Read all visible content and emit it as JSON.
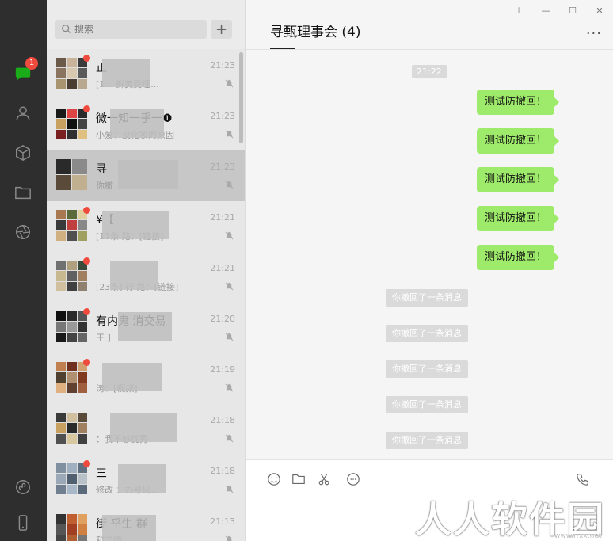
{
  "nav": {
    "chat_badge": "1"
  },
  "search": {
    "placeholder": "搜索",
    "add_label": "+"
  },
  "chat_list": [
    {
      "name": "正",
      "time": "21:23",
      "msg": "[1... 鲜美受理...",
      "dot": true
    },
    {
      "name": "微一知一乎一❶",
      "time": "21:23",
      "msg": "小爱：没化妆的原因",
      "dot": true
    },
    {
      "name": "寻",
      "time": "21:23",
      "msg": "你撤",
      "dot": false
    },
    {
      "name": "¥【",
      "time": "21:21",
      "msg": "[11条 路：[链接]",
      "dot": true
    },
    {
      "name": "",
      "time": "21:21",
      "msg": "[23条] 行 路：[链接]",
      "dot": true
    },
    {
      "name": "有内鬼 消交易",
      "time": "21:20",
      "msg": "王 ]",
      "dot": true
    },
    {
      "name": "",
      "time": "21:19",
      "msg": "涛：[视频]",
      "dot": true
    },
    {
      "name": "",
      "time": "21:18",
      "msg": "：我不够优秀",
      "dot": false
    },
    {
      "name": "三",
      "time": "21:18",
      "msg": "修改 ：办号码...",
      "dot": true
    },
    {
      "name": "街 乎生 群",
      "time": "21:13",
      "msg": "和了婚",
      "dot": false
    }
  ],
  "window": {
    "pin": "⊥",
    "minimize": "—",
    "maximize": "☐",
    "close": "✕"
  },
  "chat": {
    "title": "寻甄理事会 (4)",
    "more": "···",
    "time_tag": "21:22",
    "messages": [
      "测试防撤回！",
      "测试防撤回！",
      "测试防撤回！",
      "测试防撤回！",
      "测试防撤回！"
    ],
    "system_notices": [
      "你撤回了一条消息",
      "你撤回了一条消息",
      "你撤回了一条消息",
      "你撤回了一条消息",
      "你撤回了一条消息"
    ]
  },
  "watermark": {
    "text": "人人软件园",
    "url": "www.rrxx.net"
  },
  "colors": {
    "nav_bg": "#2e2e2e",
    "bubble_green": "#9eea6a",
    "badge_red": "#f04a3e"
  }
}
